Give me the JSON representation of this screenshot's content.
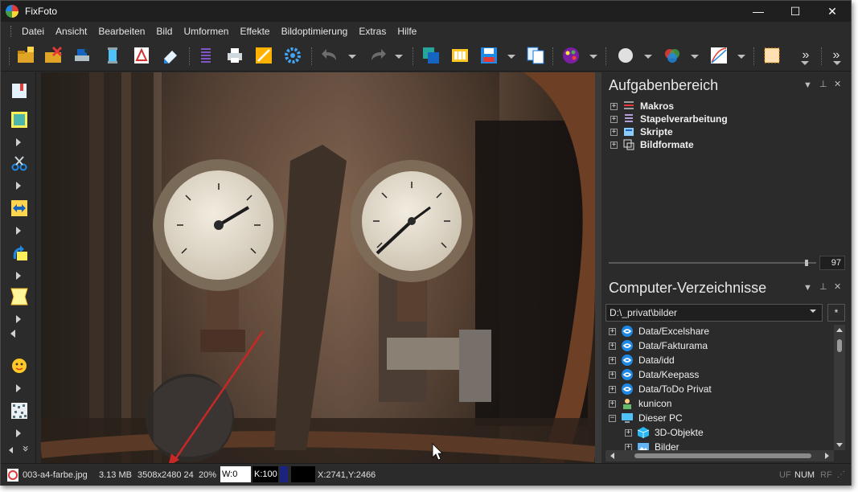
{
  "window": {
    "title": "FixFoto",
    "minimize": "—",
    "maximize": "☐",
    "close": "✕"
  },
  "menu": [
    "Datei",
    "Ansicht",
    "Bearbeiten",
    "Bild",
    "Umformen",
    "Effekte",
    "Bildoptimierung",
    "Extras",
    "Hilfe"
  ],
  "task_panel": {
    "title": "Aufgabenbereich",
    "items": [
      "Makros",
      "Stapelverarbeitung",
      "Skripte",
      "Bildformate"
    ],
    "slider_value": "97"
  },
  "dir_panel": {
    "title": "Computer-Verzeichnisse",
    "path": "D:\\_privat\\bilder",
    "filter": "*",
    "items": [
      {
        "label": "Data/Excelshare",
        "icon": "cloud-sync-icon",
        "expander": "+"
      },
      {
        "label": "Data/Fakturama",
        "icon": "cloud-sync-icon",
        "expander": "+"
      },
      {
        "label": "Data/idd",
        "icon": "cloud-sync-icon",
        "expander": "+"
      },
      {
        "label": "Data/Keepass",
        "icon": "cloud-sync-icon",
        "expander": "+"
      },
      {
        "label": "Data/ToDo Privat",
        "icon": "cloud-sync-icon",
        "expander": "+"
      },
      {
        "label": "kunicon",
        "icon": "user-folder-icon",
        "expander": "+"
      },
      {
        "label": "Dieser PC",
        "icon": "computer-icon",
        "expander": "−"
      },
      {
        "label": "3D-Objekte",
        "icon": "cube-icon",
        "expander": "+"
      },
      {
        "label": "Bilder",
        "icon": "pictures-folder-icon",
        "expander": "+"
      }
    ]
  },
  "status": {
    "filename": "003-a4-farbe.jpg",
    "filesize": "3.13 MB",
    "dimensions": "3508x2480 24",
    "zoom": "20%",
    "w_field": "W:0",
    "k_field": "K:100",
    "coords": "X:2741,Y:2466",
    "uf": "UF",
    "num": "NUM",
    "rf": "RF"
  },
  "colors": {
    "background": "#2b2b2b",
    "titlebar": "#1f1f1f",
    "accent_blue": "#1e88e5",
    "arrow_red": "#c62828"
  }
}
